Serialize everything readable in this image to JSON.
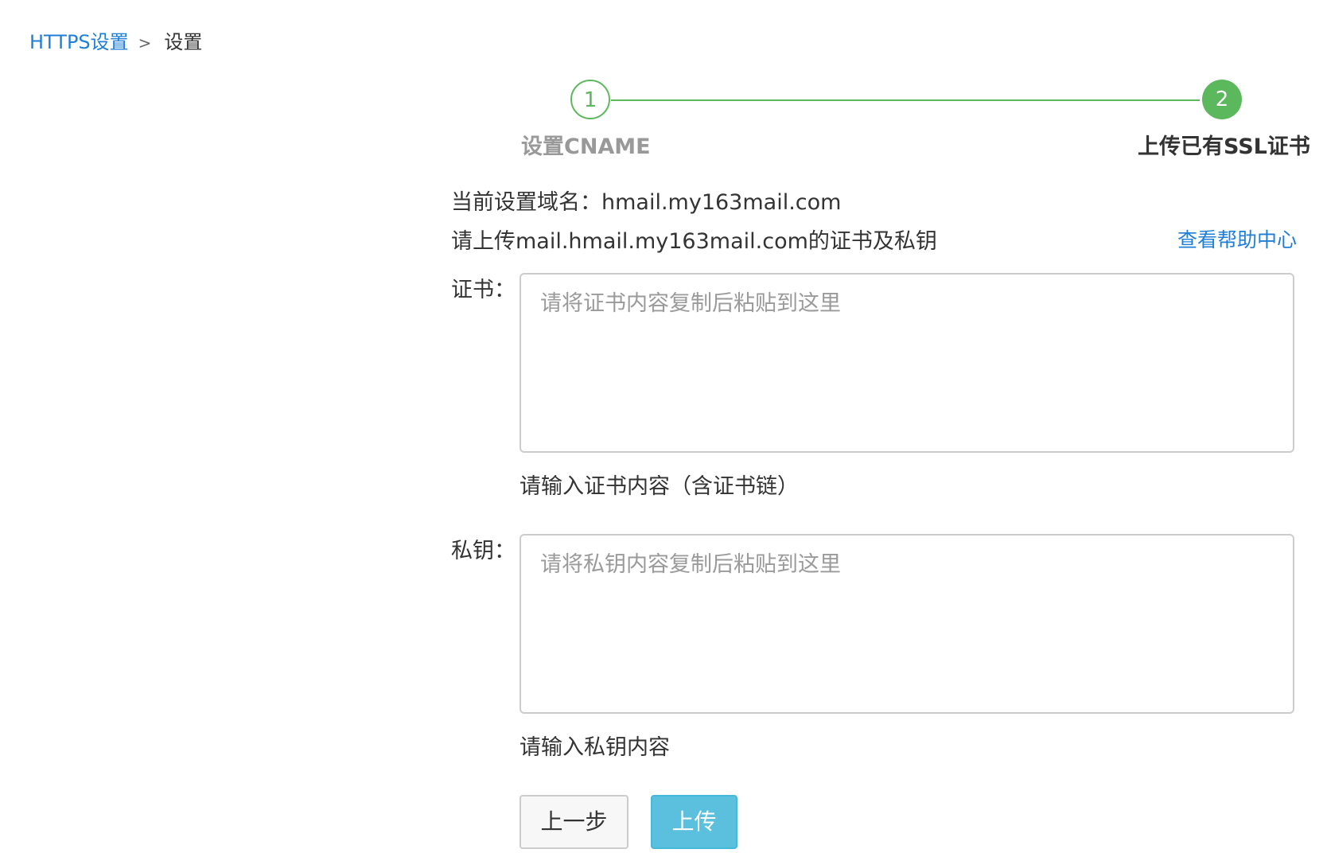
{
  "breadcrumb": {
    "parent": "HTTPS设置",
    "separator": ">",
    "current": "设置"
  },
  "steps": [
    {
      "number": "1",
      "label": "设置CNAME",
      "state": "completed"
    },
    {
      "number": "2",
      "label": "上传已有SSL证书",
      "state": "active"
    }
  ],
  "info": {
    "domain_line": "当前设置域名：hmail.my163mail.com",
    "upload_line": "请上传mail.hmail.my163mail.com的证书及私钥",
    "help_link": "查看帮助中心"
  },
  "form": {
    "cert": {
      "label": "证书：",
      "placeholder": "请将证书内容复制后粘贴到这里",
      "hint": "请输入证书内容（含证书链）"
    },
    "key": {
      "label": "私钥：",
      "placeholder": "请将私钥内容复制后粘贴到这里",
      "hint": "请输入私钥内容"
    }
  },
  "buttons": {
    "prev": "上一步",
    "upload": "上传"
  },
  "colors": {
    "step_green": "#5cb85c",
    "link_blue": "#1f7fd6",
    "primary_button": "#5bc0de"
  }
}
